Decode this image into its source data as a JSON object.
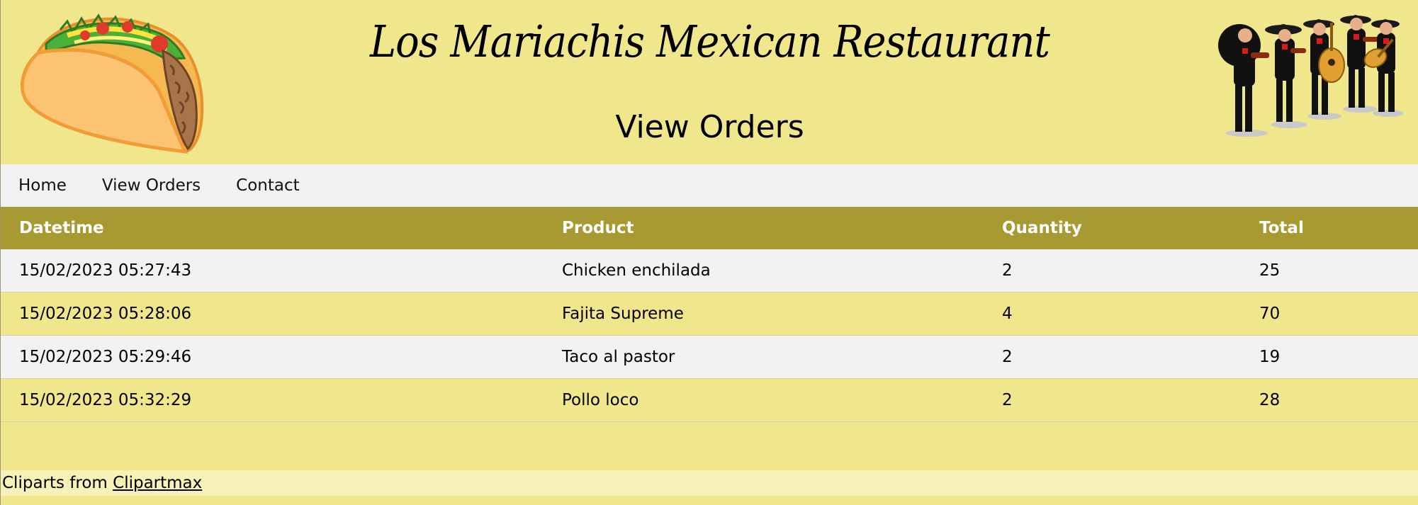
{
  "header": {
    "site_title": "Los Mariachis Mexican Restaurant",
    "page_title": "View Orders"
  },
  "nav": {
    "items": [
      {
        "label": "Home"
      },
      {
        "label": "View Orders"
      },
      {
        "label": "Contact"
      }
    ]
  },
  "orders": {
    "columns": [
      "Datetime",
      "Product",
      "Quantity",
      "Total"
    ],
    "rows": [
      {
        "datetime": "15/02/2023 05:27:43",
        "product": "Chicken enchilada",
        "quantity": "2",
        "total": "25"
      },
      {
        "datetime": "15/02/2023 05:28:06",
        "product": "Fajita Supreme",
        "quantity": "4",
        "total": "70"
      },
      {
        "datetime": "15/02/2023 05:29:46",
        "product": "Taco al pastor",
        "quantity": "2",
        "total": "19"
      },
      {
        "datetime": "15/02/2023 05:32:29",
        "product": "Pollo loco",
        "quantity": "2",
        "total": "28"
      }
    ]
  },
  "footer": {
    "text": "Cliparts from ",
    "link_label": "Clipartmax"
  },
  "colors": {
    "background": "#f0e68c",
    "nav_background": "#f2f2f2",
    "table_header": "#a89a32",
    "footer_background": "#f8f1b8"
  },
  "images": {
    "left_logo": "taco-icon",
    "right_logo": "mariachi-band-icon"
  }
}
